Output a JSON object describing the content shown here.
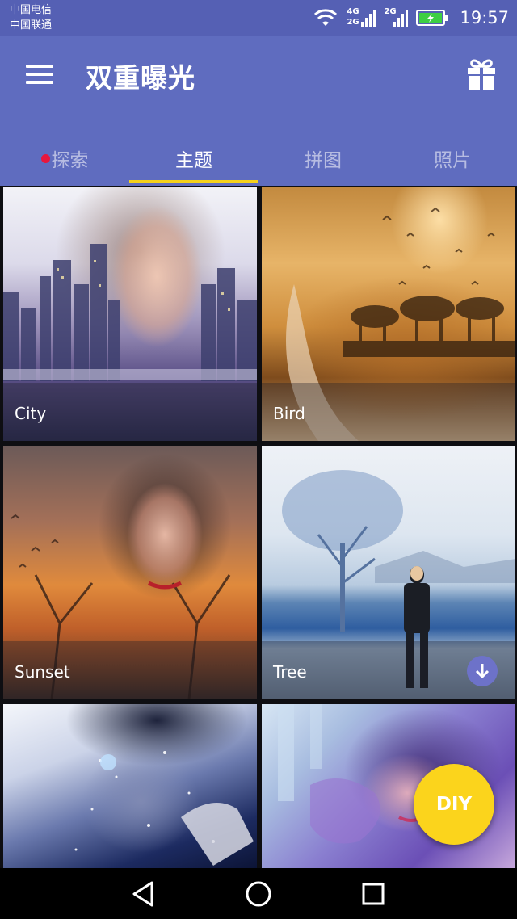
{
  "status_bar": {
    "carrier_1": "中国电信",
    "carrier_2": "中国联通",
    "network_1": "4G",
    "network_2": "2G",
    "network_3": "2G",
    "time": "19:57"
  },
  "app_bar": {
    "title": "双重曝光"
  },
  "tabs": [
    {
      "label": "探索",
      "badge": true
    },
    {
      "label": "主题",
      "active": true
    },
    {
      "label": "拼图"
    },
    {
      "label": "照片"
    }
  ],
  "themes": [
    {
      "label": "City"
    },
    {
      "label": "Bird"
    },
    {
      "label": "Sunset"
    },
    {
      "label": "Tree",
      "downloadable": true
    },
    {
      "label": ""
    },
    {
      "label": ""
    }
  ],
  "fab": {
    "label": "DIY"
  },
  "colors": {
    "primary": "#5f6cbf",
    "status_bar": "#5560b4",
    "accent": "#f5d11c",
    "badge": "#e8173d"
  }
}
